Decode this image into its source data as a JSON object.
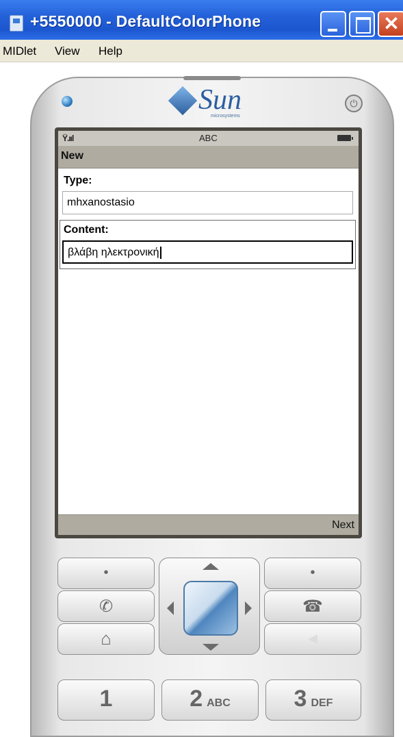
{
  "window": {
    "title": "+5550000 - DefaultColorPhone",
    "minimize_icon": "minimize-icon",
    "maximize_icon": "maximize-icon",
    "close_glyph": "✕"
  },
  "menubar": {
    "items": [
      "MIDlet",
      "View",
      "Help"
    ]
  },
  "phone": {
    "brand": "Sun",
    "brand_sub": "microsystems",
    "power_glyph": "⏻"
  },
  "screen": {
    "status": {
      "input_mode": "ABC",
      "signal_glyph": "Ÿ.ııl"
    },
    "form_title": "New",
    "fields": [
      {
        "label": "Type:",
        "value": "mhxanostasio"
      },
      {
        "label": "Content:",
        "value": "βλάβη ηλεκτρονική"
      }
    ],
    "softkey_right": "Next"
  },
  "keypad": {
    "soft_left_dot": "•",
    "soft_right_dot": "•",
    "call_glyph": "✆",
    "end_glyph": "☎",
    "home_glyph": "⌂",
    "clear_glyph": "◀",
    "keys": [
      {
        "digit": "1",
        "letters": ""
      },
      {
        "digit": "2",
        "letters": "ABC"
      },
      {
        "digit": "3",
        "letters": "DEF"
      }
    ]
  },
  "colors": {
    "titlebar": "#2461d8",
    "screen_bar": "#afaba1",
    "status_bar": "#c9c7c0",
    "sun_blue": "#2c5ea0"
  }
}
